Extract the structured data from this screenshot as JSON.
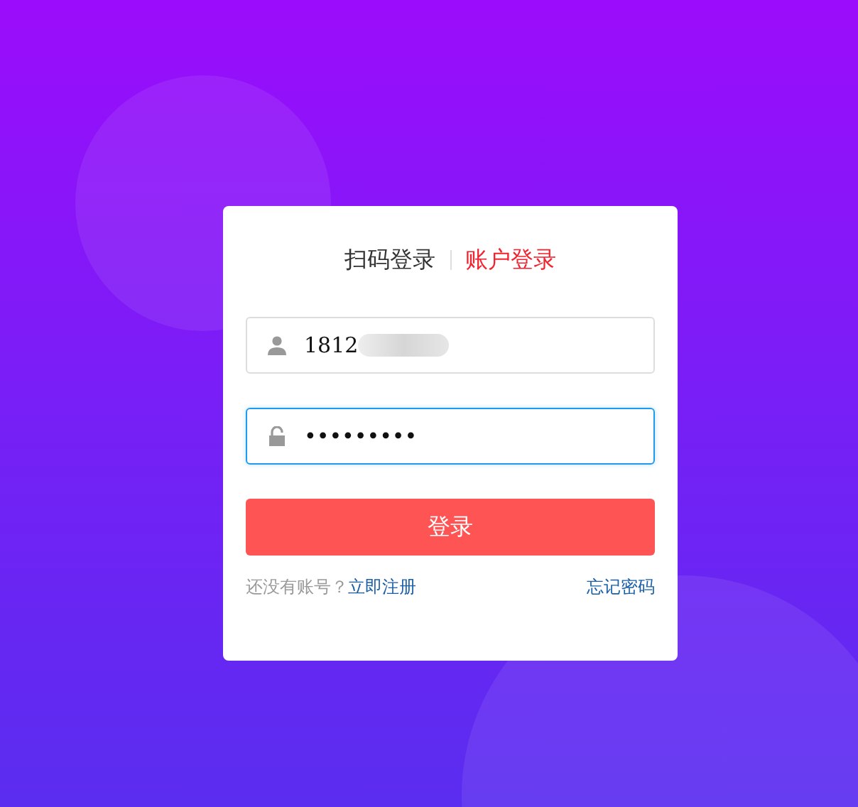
{
  "tabs": [
    {
      "label": "扫码登录",
      "selected": false
    },
    {
      "label": "账户登录",
      "selected": true
    }
  ],
  "fields": [
    {
      "kind": "user",
      "value": "1812",
      "redacted": true,
      "focused": false
    },
    {
      "kind": "password",
      "value": "•••••••••",
      "redacted": false,
      "focused": true
    }
  ],
  "login_button": "登录",
  "register": {
    "prompt": "还没有账号？",
    "link": "立即注册"
  },
  "forgot_link": "忘记密码"
}
